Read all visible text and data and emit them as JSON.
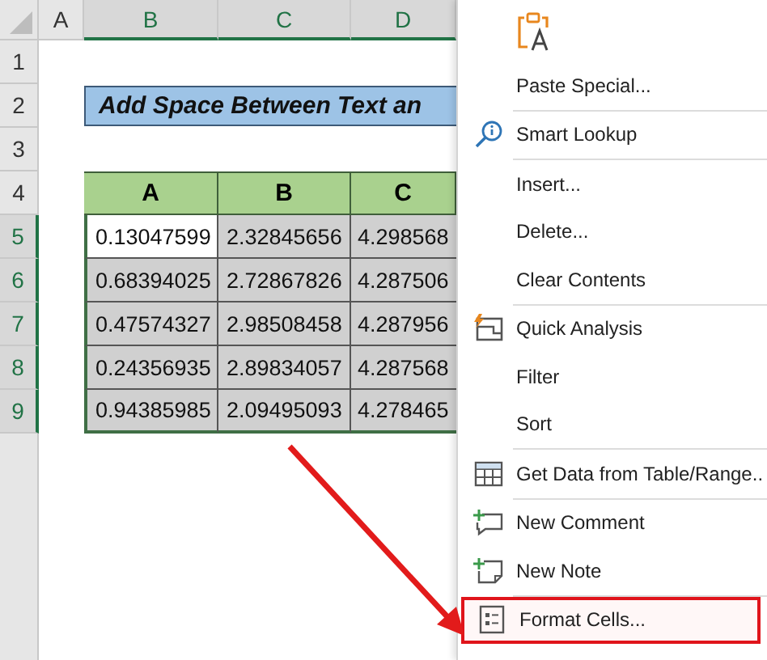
{
  "sheet": {
    "column_headers": [
      {
        "label": "A",
        "selected": false
      },
      {
        "label": "B",
        "selected": true
      },
      {
        "label": "C",
        "selected": true
      },
      {
        "label": "D",
        "selected": true
      }
    ],
    "rows": [
      {
        "number": "1",
        "selected": false,
        "kind": "blank"
      },
      {
        "number": "2",
        "selected": false,
        "kind": "title",
        "text": "Add Space Between Text an"
      },
      {
        "number": "3",
        "selected": false,
        "kind": "blank"
      },
      {
        "number": "4",
        "selected": false,
        "kind": "table-header",
        "cells": [
          "A",
          "B",
          "C"
        ]
      },
      {
        "number": "5",
        "selected": true,
        "kind": "data",
        "cells": [
          {
            "text": "0.13047599",
            "active": true
          },
          {
            "text": "2.32845656",
            "active": false
          },
          {
            "text": "4.298568",
            "active": false
          }
        ]
      },
      {
        "number": "6",
        "selected": true,
        "kind": "data",
        "cells": [
          {
            "text": "0.68394025",
            "active": false
          },
          {
            "text": "2.72867826",
            "active": false
          },
          {
            "text": "4.287506",
            "active": false
          }
        ]
      },
      {
        "number": "7",
        "selected": true,
        "kind": "data",
        "cells": [
          {
            "text": "0.47574327",
            "active": false
          },
          {
            "text": "2.98508458",
            "active": false
          },
          {
            "text": "4.287956",
            "active": false
          }
        ]
      },
      {
        "number": "8",
        "selected": true,
        "kind": "data",
        "cells": [
          {
            "text": "0.24356935",
            "active": false
          },
          {
            "text": "2.89834057",
            "active": false
          },
          {
            "text": "4.287568",
            "active": false
          }
        ]
      },
      {
        "number": "9",
        "selected": true,
        "kind": "data",
        "cells": [
          {
            "text": "0.94385985",
            "active": false
          },
          {
            "text": "2.09495093",
            "active": false
          },
          {
            "text": "4.278465",
            "active": false
          }
        ]
      }
    ]
  },
  "context_menu": {
    "groups": [
      [
        {
          "kind": "paste-options"
        },
        {
          "kind": "plain",
          "label": "Paste Special...",
          "highlighted": false
        }
      ],
      [
        {
          "kind": "lookup",
          "label": "Smart Lookup",
          "highlighted": false
        }
      ],
      [
        {
          "kind": "plain",
          "label": "Insert...",
          "highlighted": false
        },
        {
          "kind": "plain",
          "label": "Delete...",
          "highlighted": false
        },
        {
          "kind": "plain",
          "label": "Clear Contents",
          "highlighted": false
        }
      ],
      [
        {
          "kind": "analysis",
          "label": "Quick Analysis",
          "highlighted": false
        },
        {
          "kind": "plain",
          "label": "Filter",
          "highlighted": false
        },
        {
          "kind": "plain",
          "label": "Sort",
          "highlighted": false
        }
      ],
      [
        {
          "kind": "table",
          "label": "Get Data from Table/Range..",
          "highlighted": false
        }
      ],
      [
        {
          "kind": "comment",
          "label": "New Comment",
          "highlighted": false
        },
        {
          "kind": "note",
          "label": "New Note",
          "highlighted": false
        }
      ],
      [
        {
          "kind": "format",
          "label": "Format Cells...",
          "highlighted": true
        }
      ]
    ]
  }
}
